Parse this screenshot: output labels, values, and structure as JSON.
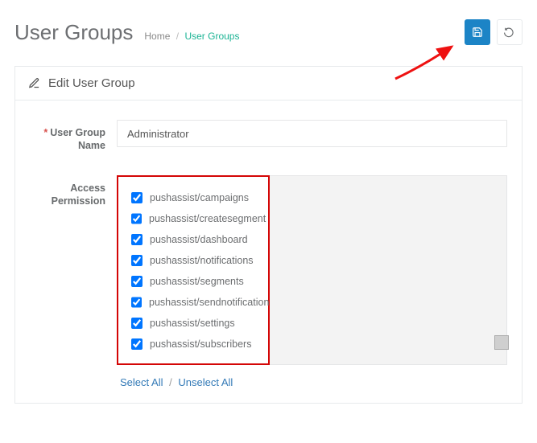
{
  "page": {
    "title": "User Groups",
    "breadcrumb_home": "Home",
    "breadcrumb_current": "User Groups"
  },
  "panel": {
    "heading": "Edit User Group"
  },
  "form": {
    "name_label": "User Group Name",
    "name_value": "Administrator",
    "perm_label": "Access Permission",
    "select_all": "Select All",
    "unselect_all": "Unselect All"
  },
  "permissions": [
    "pushassist/campaigns",
    "pushassist/createsegment",
    "pushassist/dashboard",
    "pushassist/notifications",
    "pushassist/segments",
    "pushassist/sendnotification",
    "pushassist/settings",
    "pushassist/subscribers"
  ]
}
